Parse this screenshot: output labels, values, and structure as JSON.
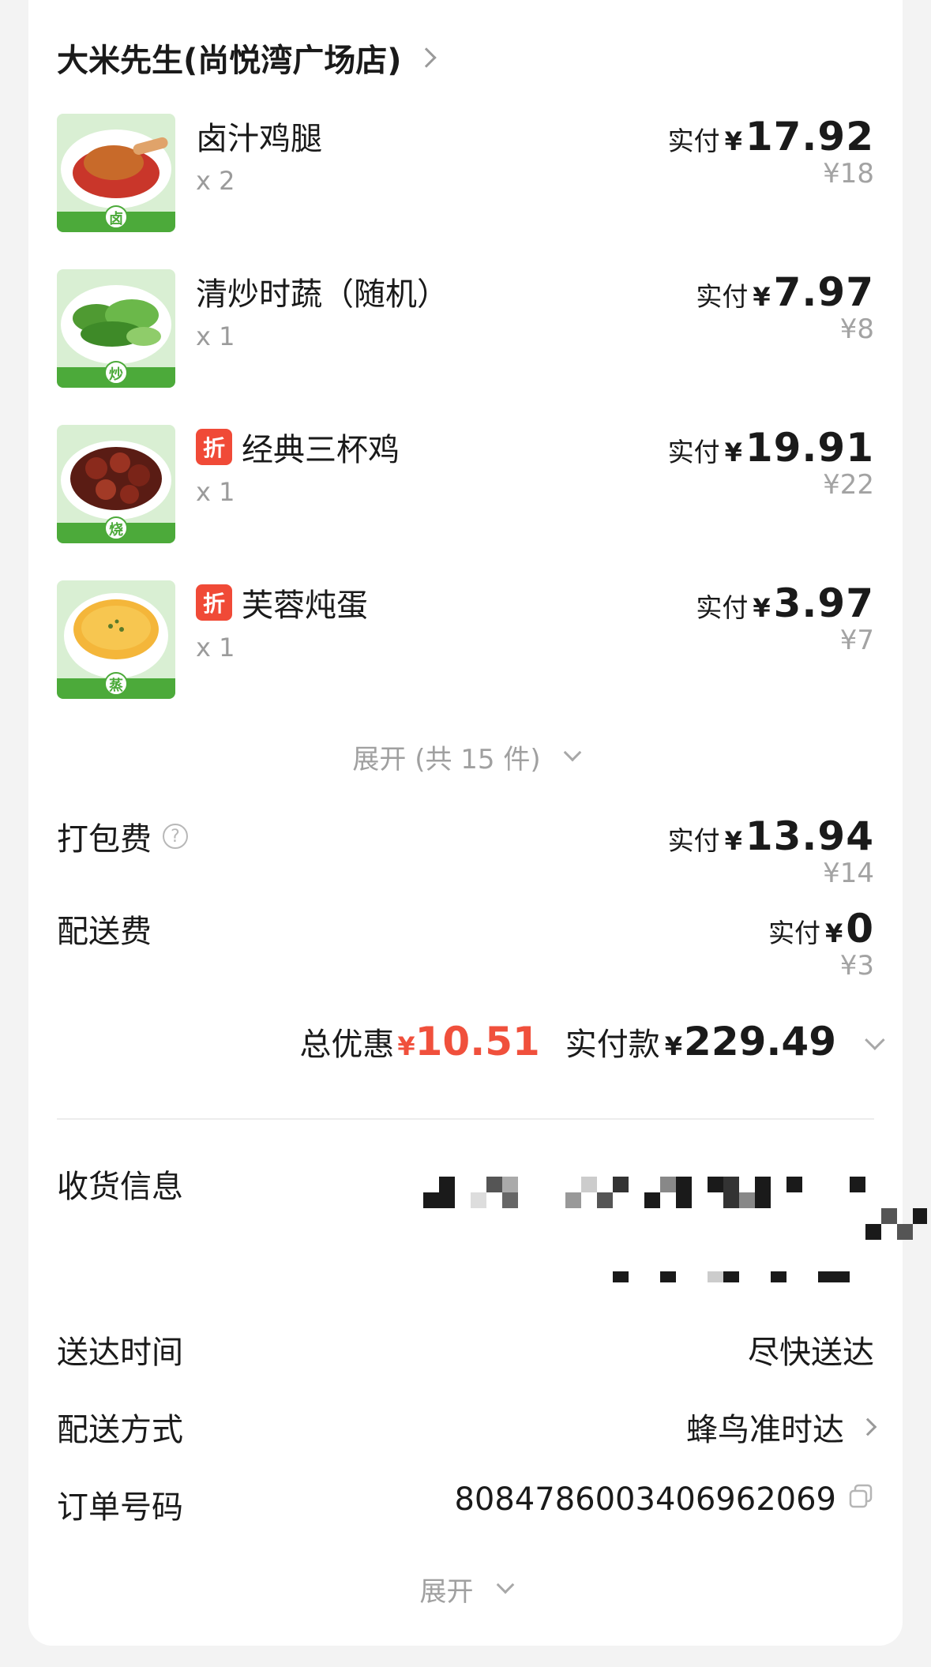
{
  "shop": {
    "name": "大米先生(尚悦湾广场店)"
  },
  "items": [
    {
      "name": "卤汁鸡腿",
      "qty": "x 2",
      "paid_label": "实付",
      "currency": "¥",
      "paid": "17.92",
      "original": "¥18",
      "badge": "卤",
      "discount_tag": ""
    },
    {
      "name": "清炒时蔬（随机）",
      "qty": "x 1",
      "paid_label": "实付",
      "currency": "¥",
      "paid": "7.97",
      "original": "¥8",
      "badge": "炒",
      "discount_tag": ""
    },
    {
      "name": "经典三杯鸡",
      "qty": "x 1",
      "paid_label": "实付",
      "currency": "¥",
      "paid": "19.91",
      "original": "¥22",
      "badge": "烧",
      "discount_tag": "折"
    },
    {
      "name": "芙蓉炖蛋",
      "qty": "x 1",
      "paid_label": "实付",
      "currency": "¥",
      "paid": "3.97",
      "original": "¥7",
      "badge": "蒸",
      "discount_tag": "折"
    }
  ],
  "items_expand": {
    "label": "展开 (共 15 件)"
  },
  "fees": {
    "packaging": {
      "label": "打包费",
      "help_icon": "?",
      "paid_label": "实付",
      "currency": "¥",
      "paid": "13.94",
      "original": "¥14"
    },
    "delivery": {
      "label": "配送费",
      "paid_label": "实付",
      "currency": "¥",
      "paid": "0",
      "original": "¥3"
    }
  },
  "summary": {
    "discount_label": "总优惠",
    "discount_currency": "¥",
    "discount_amount": "10.51",
    "total_label": "实付款",
    "total_currency": "¥",
    "total_amount": "229.49"
  },
  "info": {
    "receiver_label": "收货信息",
    "delivery_time_label": "送达时间",
    "delivery_time_value": "尽快送达",
    "delivery_method_label": "配送方式",
    "delivery_method_value": "蜂鸟准时达",
    "order_no_label": "订单号码",
    "order_no_value": "8084786003406962069"
  },
  "bottom_expand": {
    "label": "展开"
  },
  "colors": {
    "accent_red": "#f0503c",
    "tag_red": "#f04a37",
    "badge_green": "#4caa3a"
  },
  "icons": [
    "chevron-right-icon",
    "chevron-down-icon",
    "help-icon",
    "copy-icon",
    "discount-tag"
  ]
}
